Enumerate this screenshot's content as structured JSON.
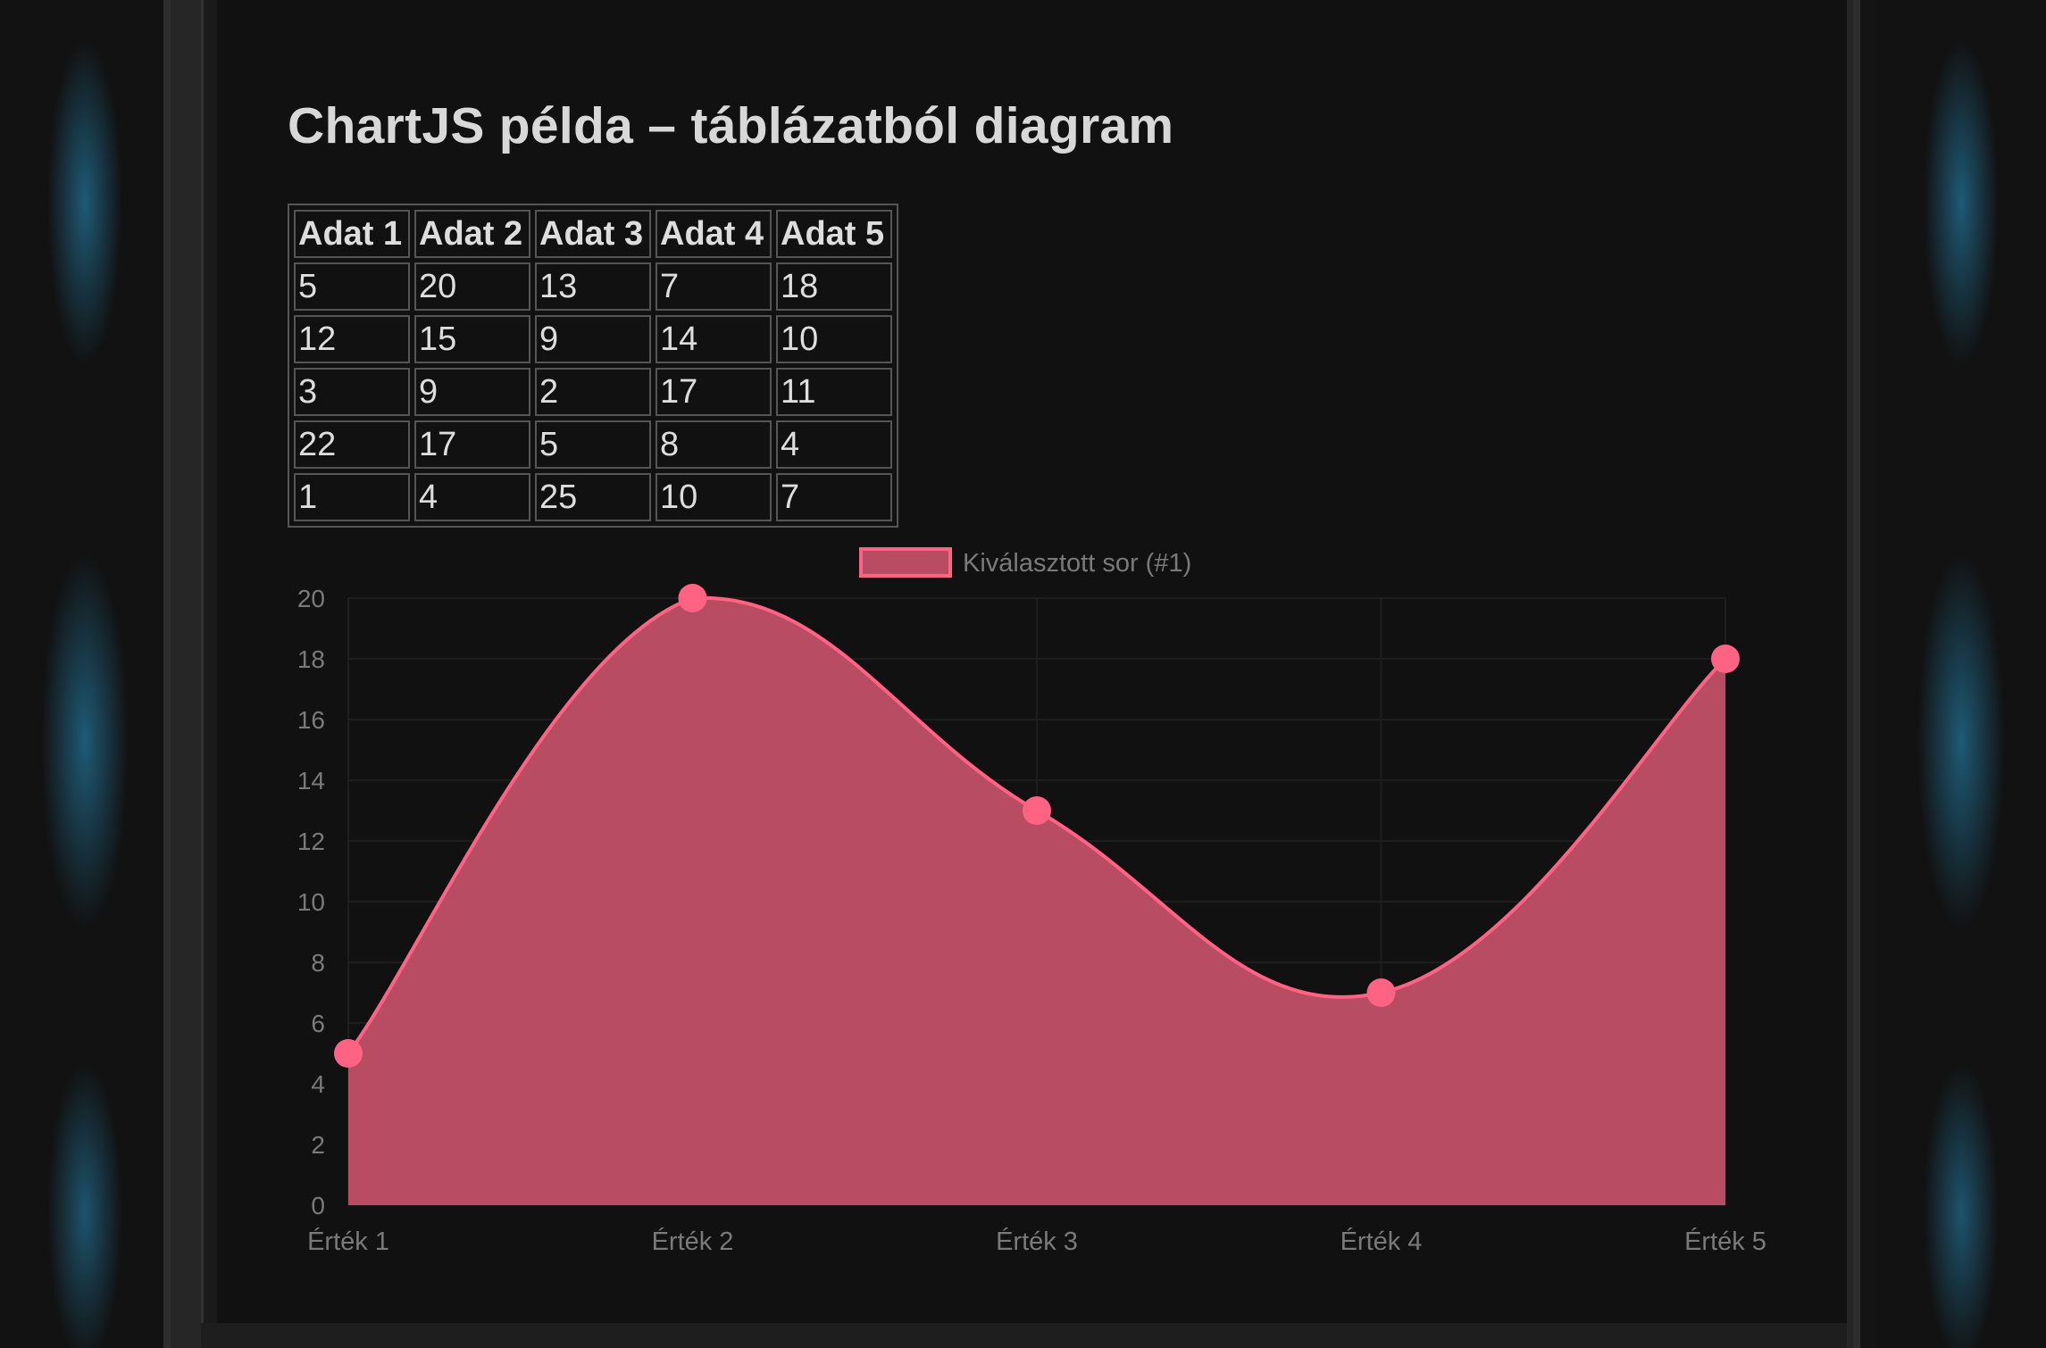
{
  "page": {
    "title": "ChartJS példa – táblázatból diagram"
  },
  "table": {
    "headers": [
      "Adat 1",
      "Adat 2",
      "Adat 3",
      "Adat 4",
      "Adat 5"
    ],
    "rows": [
      [
        "5",
        "20",
        "13",
        "7",
        "18"
      ],
      [
        "12",
        "15",
        "9",
        "14",
        "10"
      ],
      [
        "3",
        "9",
        "2",
        "17",
        "11"
      ],
      [
        "22",
        "17",
        "5",
        "8",
        "4"
      ],
      [
        "1",
        "4",
        "25",
        "10",
        "7"
      ]
    ]
  },
  "chart_data": {
    "type": "area",
    "categories": [
      "Érték 1",
      "Érték 2",
      "Érték 3",
      "Érték 4",
      "Érték 5"
    ],
    "series": [
      {
        "name": "Kiválasztott sor (#1)",
        "values": [
          5,
          20,
          13,
          7,
          18
        ]
      }
    ],
    "ylim": [
      0,
      20
    ],
    "yticks": [
      0,
      2,
      4,
      6,
      8,
      10,
      12,
      14,
      16,
      18,
      20
    ],
    "legend": "top-center",
    "grid": true,
    "colors": {
      "line": "#ff6384",
      "fill": "#b84c63",
      "point": "#ff6384",
      "tick_text": "#7a7a7a",
      "grid": "#1e1e1e"
    }
  }
}
